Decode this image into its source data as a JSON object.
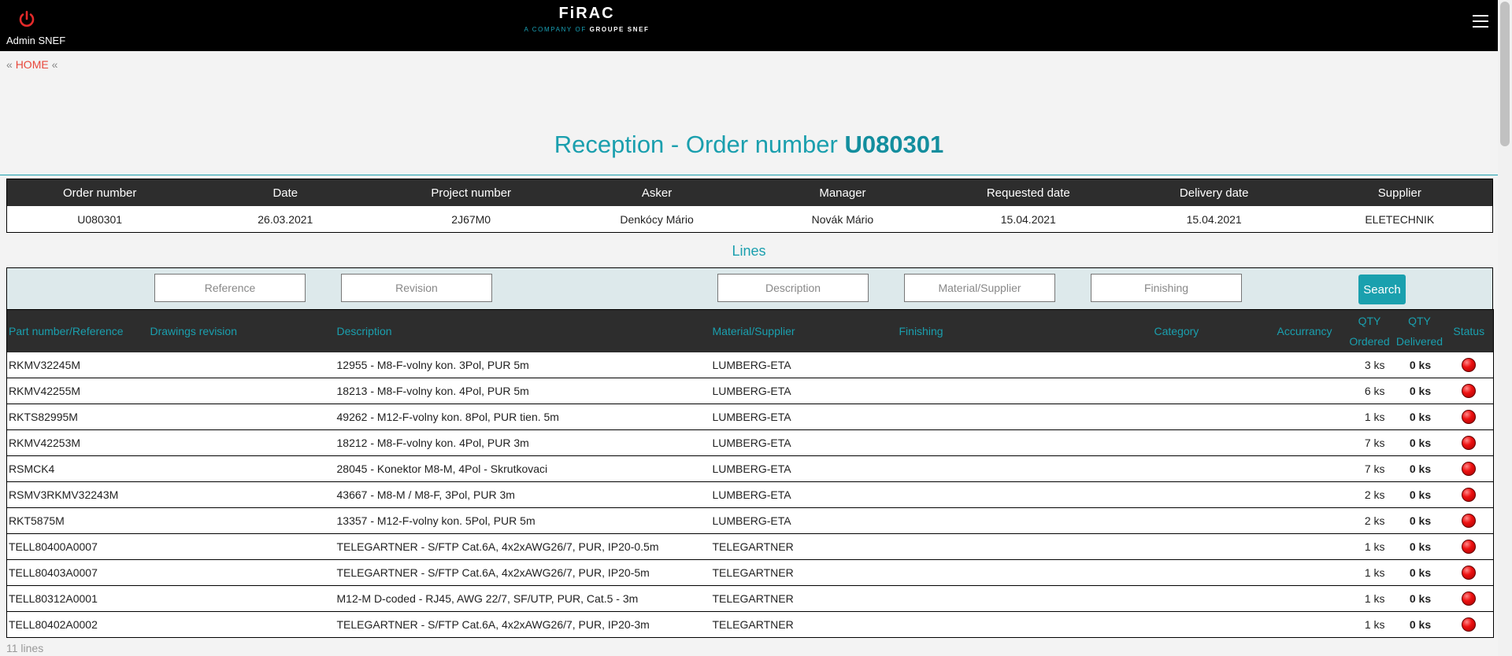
{
  "header": {
    "user_name": "Admin SNEF",
    "logo_text": "FiRAC",
    "logo_sub_prefix": "A COMPANY OF",
    "logo_sub_brand": "GROUPE SNEF"
  },
  "breadcrumb": {
    "prefix": "«",
    "home": "HOME",
    "suffix": "«"
  },
  "title": {
    "prefix": "Reception - Order number",
    "order": "U080301"
  },
  "summary": {
    "headers": [
      "Order number",
      "Date",
      "Project number",
      "Asker",
      "Manager",
      "Requested date",
      "Delivery date",
      "Supplier"
    ],
    "values": [
      "U080301",
      "26.03.2021",
      "2J67M0",
      "Denkócy Mário",
      "Novák Mário",
      "15.04.2021",
      "15.04.2021",
      "ELETECHNIK"
    ]
  },
  "lines_title": "Lines",
  "filters": {
    "reference": "Reference",
    "revision": "Revision",
    "description": "Description",
    "material": "Material/Supplier",
    "finishing": "Finishing",
    "search": "Search"
  },
  "lines_table": {
    "headers": {
      "part": "Part number/Reference",
      "revision": "Drawings revision",
      "description": "Description",
      "material": "Material/Supplier",
      "finishing": "Finishing",
      "category": "Category",
      "accuracy": "Accurrancy",
      "qty_ordered_1": "QTY",
      "qty_ordered_2": "Ordered",
      "qty_delivered_1": "QTY",
      "qty_delivered_2": "Delivered",
      "status": "Status"
    },
    "rows": [
      {
        "part": "RKMV32245M",
        "description": "12955 - M8-F-volny kon. 3Pol, PUR 5m",
        "material": "LUMBERG-ETA",
        "ordered": "3 ks",
        "delivered": "0 ks"
      },
      {
        "part": "RKMV42255M",
        "description": "18213 - M8-F-volny kon. 4Pol, PUR 5m",
        "material": "LUMBERG-ETA",
        "ordered": "6 ks",
        "delivered": "0 ks"
      },
      {
        "part": "RKTS82995M",
        "description": "49262 - M12-F-volny kon. 8Pol, PUR tien. 5m",
        "material": "LUMBERG-ETA",
        "ordered": "1 ks",
        "delivered": "0 ks"
      },
      {
        "part": "RKMV42253M",
        "description": "18212 - M8-F-volny kon. 4Pol, PUR 3m",
        "material": "LUMBERG-ETA",
        "ordered": "7 ks",
        "delivered": "0 ks"
      },
      {
        "part": "RSMCK4",
        "description": "28045 - Konektor M8-M, 4Pol - Skrutkovaci",
        "material": "LUMBERG-ETA",
        "ordered": "7 ks",
        "delivered": "0 ks"
      },
      {
        "part": "RSMV3RKMV32243M",
        "description": "43667 - M8-M / M8-F, 3Pol, PUR 3m",
        "material": "LUMBERG-ETA",
        "ordered": "2 ks",
        "delivered": "0 ks"
      },
      {
        "part": "RKT5875M",
        "description": "13357 - M12-F-volny kon. 5Pol, PUR 5m",
        "material": "LUMBERG-ETA",
        "ordered": "2 ks",
        "delivered": "0 ks"
      },
      {
        "part": "TELL80400A0007",
        "description": "TELEGARTNER - S/FTP Cat.6A, 4x2xAWG26/7, PUR, IP20-0.5m",
        "material": "TELEGARTNER",
        "ordered": "1 ks",
        "delivered": "0 ks"
      },
      {
        "part": "TELL80403A0007",
        "description": "TELEGARTNER - S/FTP Cat.6A, 4x2xAWG26/7, PUR, IP20-5m",
        "material": "TELEGARTNER",
        "ordered": "1 ks",
        "delivered": "0 ks"
      },
      {
        "part": "TELL80312A0001",
        "description": "M12-M D-coded - RJ45, AWG 22/7, SF/UTP, PUR, Cat.5 - 3m",
        "material": "TELEGARTNER",
        "ordered": "1 ks",
        "delivered": "0 ks"
      },
      {
        "part": "TELL80402A0002",
        "description": "TELEGARTNER - S/FTP Cat.6A, 4x2xAWG26/7, PUR, IP20-3m",
        "material": "TELEGARTNER",
        "ordered": "1 ks",
        "delivered": "0 ks"
      }
    ]
  },
  "line_count": "11 lines",
  "colors": {
    "accent": "#1a9fae",
    "header_bg": "#2d2d2d",
    "status_red": "#ee1111",
    "link": "#e8473b"
  }
}
